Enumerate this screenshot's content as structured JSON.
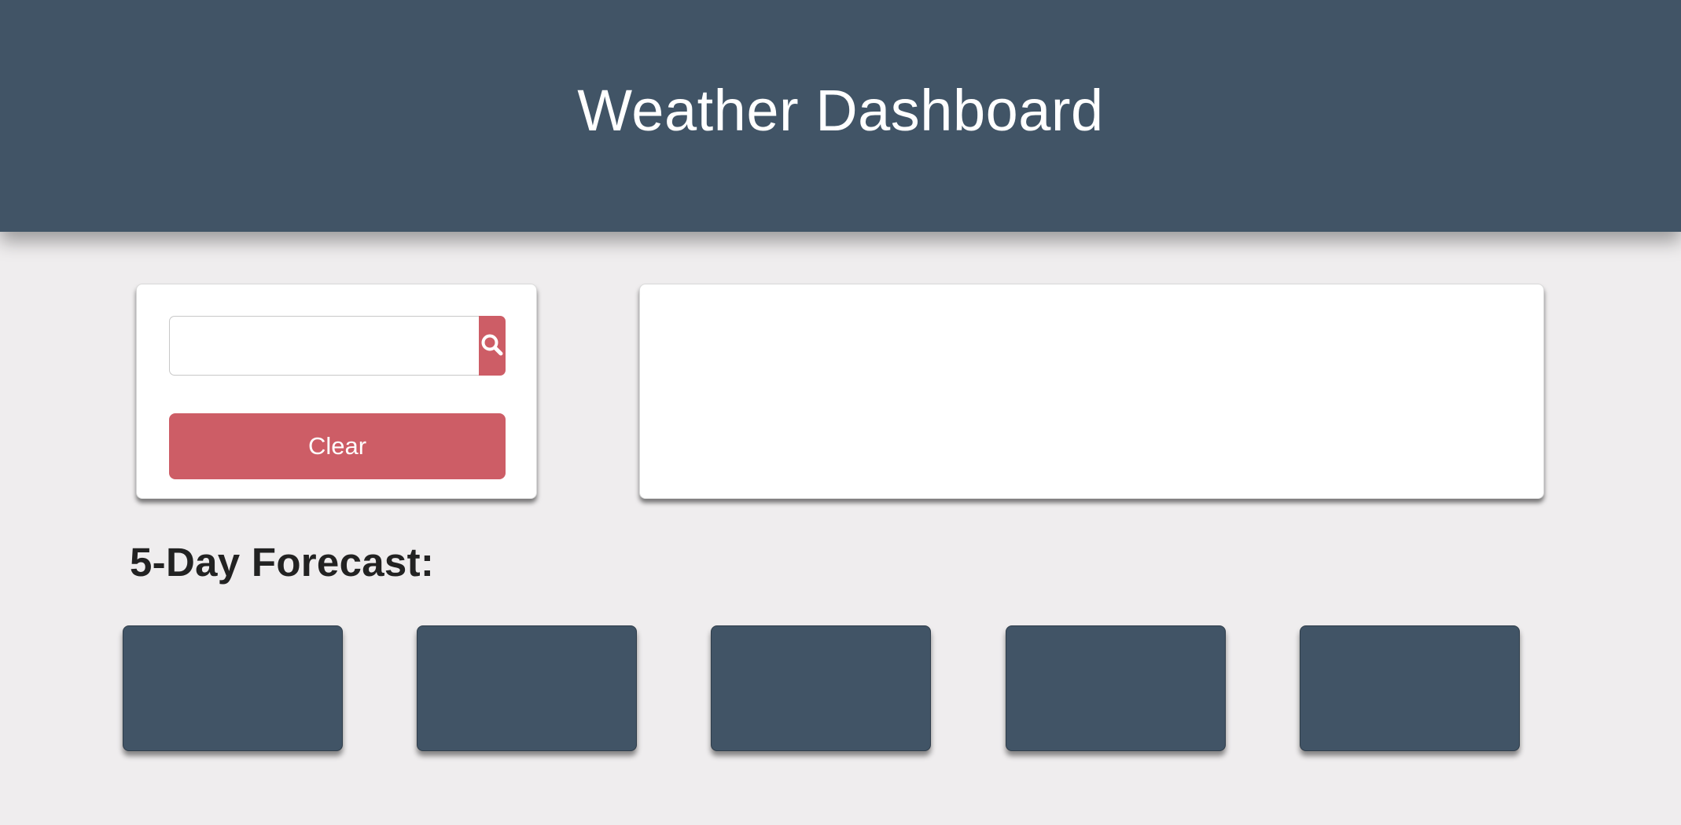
{
  "header": {
    "title": "Weather Dashboard"
  },
  "search": {
    "input_value": "",
    "placeholder": "",
    "search_icon": "search-icon",
    "clear_label": "Clear"
  },
  "current_weather": {},
  "forecast": {
    "title": "5-Day Forecast:",
    "cards": [
      {},
      {},
      {},
      {},
      {}
    ]
  },
  "colors": {
    "header_bg": "#415466",
    "accent_button": "#cd5d66",
    "page_bg": "#efedee",
    "card_bg": "#ffffff",
    "forecast_card_bg": "#415466"
  }
}
